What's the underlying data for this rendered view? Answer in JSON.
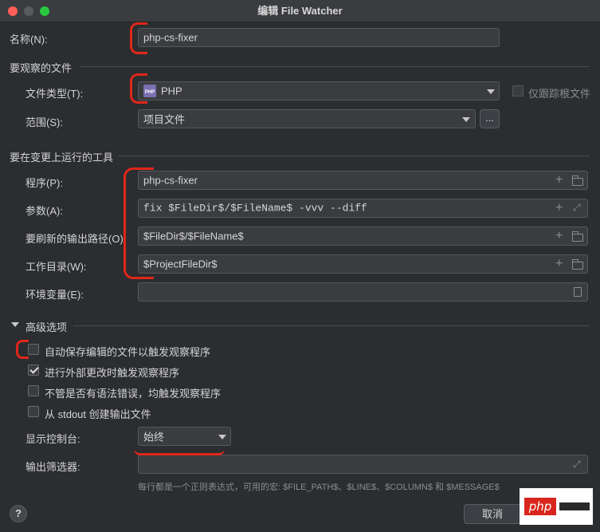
{
  "window": {
    "title": "编辑 File Watcher"
  },
  "name_field": {
    "label": "名称(N):",
    "value": "php-cs-fixer"
  },
  "files_section": {
    "title": "要观察的文件",
    "file_type_label": "文件类型(T):",
    "file_type_value": "PHP",
    "file_type_icon": "php-file-icon",
    "track_root_label": "仅跟踪根文件",
    "scope_label": "范围(S):",
    "scope_value": "项目文件",
    "scope_more_label": "..."
  },
  "tool_section": {
    "title": "要在变更上运行的工具",
    "program_label": "程序(P):",
    "program_value": "php-cs-fixer",
    "args_label": "参数(A):",
    "args_value": "fix $FileDir$/$FileName$ -vvv --diff",
    "output_label": "要刷新的输出路径(O)",
    "output_value": "$FileDir$/$FileName$",
    "workdir_label": "工作目录(W):",
    "workdir_value": "$ProjectFileDir$",
    "env_label": "环境变量(E):",
    "env_value": ""
  },
  "advanced": {
    "title": "高级选项",
    "options": [
      {
        "label": "自动保存编辑的文件以触发观察程序",
        "checked": false
      },
      {
        "label": "进行外部更改时触发观察程序",
        "checked": true
      },
      {
        "label": "不管是否有语法错误，均触发观察程序",
        "checked": false
      },
      {
        "label": "从 stdout 创建输出文件",
        "checked": false
      }
    ],
    "console_label": "显示控制台:",
    "console_value": "始终",
    "filter_label": "输出筛选器:",
    "filter_value": "",
    "filter_hint": "每行都是一个正则表达式，可用的宏: $FILE_PATH$、$LINE$、$COLUMN$ 和 $MESSAGE$"
  },
  "footer": {
    "help_label": "?",
    "cancel_label": "取消"
  },
  "watermark": {
    "text": "php"
  },
  "colors": {
    "annotation_red": "#e0261b",
    "background": "#2b2d30",
    "field": "#3a3c40"
  }
}
